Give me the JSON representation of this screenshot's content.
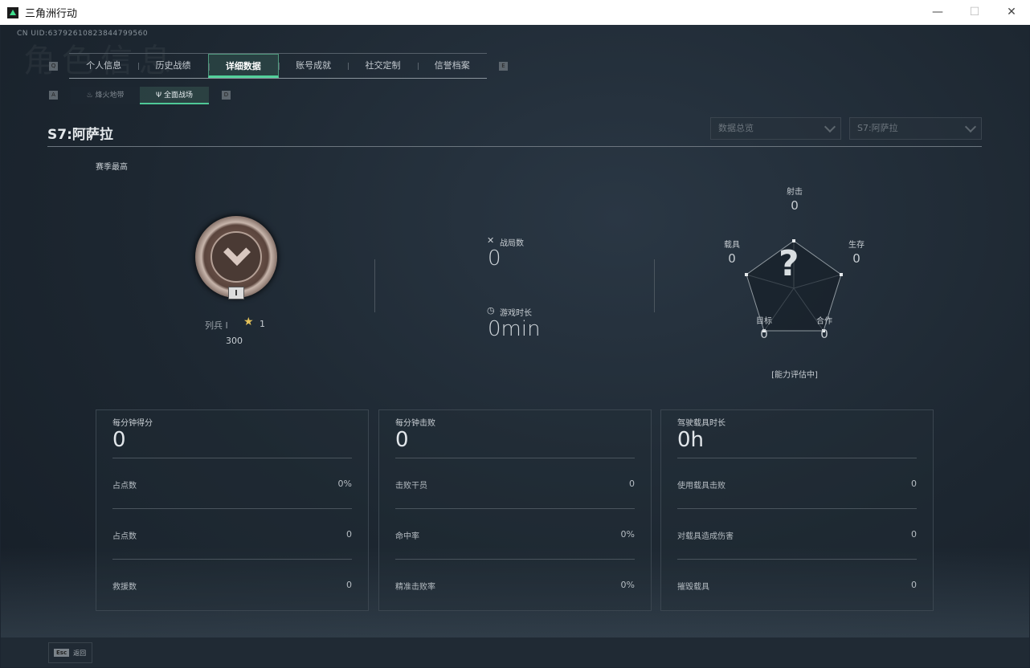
{
  "window": {
    "title": "三角洲行动",
    "minimize": "—",
    "maximize": "☐",
    "close": "✕"
  },
  "uid": "CN UID:63792610823844799560",
  "ghost_title": "角色信息",
  "keys": {
    "prev_tab": "Q",
    "next_tab": "E",
    "prev_sub": "A",
    "next_sub": "D"
  },
  "tabs": [
    "个人信息",
    "历史战绩",
    "详细数据",
    "账号成就",
    "社交定制",
    "信誉档案"
  ],
  "active_tab": "详细数据",
  "subtabs": [
    {
      "label": "烽火地带",
      "icon": "flame-icon"
    },
    {
      "label": "全面战场",
      "icon": "battlefield-icon"
    }
  ],
  "season": "S7:阿萨拉",
  "filters": {
    "mode": "数据总览",
    "season": "S7:阿萨拉"
  },
  "season_best": {
    "label": "赛季最高",
    "rank": "列兵 I",
    "stars": "1",
    "score": "300",
    "rank_numeral": "I"
  },
  "summary": {
    "matches_label": "战局数",
    "matches": "0",
    "time_label": "游戏时长",
    "time": "0min"
  },
  "radar": {
    "axes": [
      {
        "label": "射击",
        "value": "0"
      },
      {
        "label": "生存",
        "value": "0"
      },
      {
        "label": "合作",
        "value": "0"
      },
      {
        "label": "目标",
        "value": "0"
      },
      {
        "label": "载具",
        "value": "0"
      }
    ],
    "center": "?",
    "status": "[能力评估中]"
  },
  "cards": [
    {
      "title": "每分钟得分",
      "value": "0",
      "rows": [
        {
          "k": "占点数",
          "v": "0%"
        },
        {
          "k": "占点数",
          "v": "0"
        },
        {
          "k": "救援数",
          "v": "0"
        }
      ]
    },
    {
      "title": "每分钟击败",
      "value": "0",
      "rows": [
        {
          "k": "击败干员",
          "v": "0"
        },
        {
          "k": "命中率",
          "v": "0%"
        },
        {
          "k": "精准击败率",
          "v": "0%"
        }
      ]
    },
    {
      "title": "驾驶载具时长",
      "value": "0h",
      "rows": [
        {
          "k": "使用载具击败",
          "v": "0"
        },
        {
          "k": "对载具造成伤害",
          "v": "0"
        },
        {
          "k": "摧毁载具",
          "v": "0"
        }
      ]
    }
  ],
  "footer": {
    "esc_key": "Esc",
    "back": "返回"
  },
  "colors": {
    "accent": "#52d19b",
    "background": "#1c2530"
  }
}
